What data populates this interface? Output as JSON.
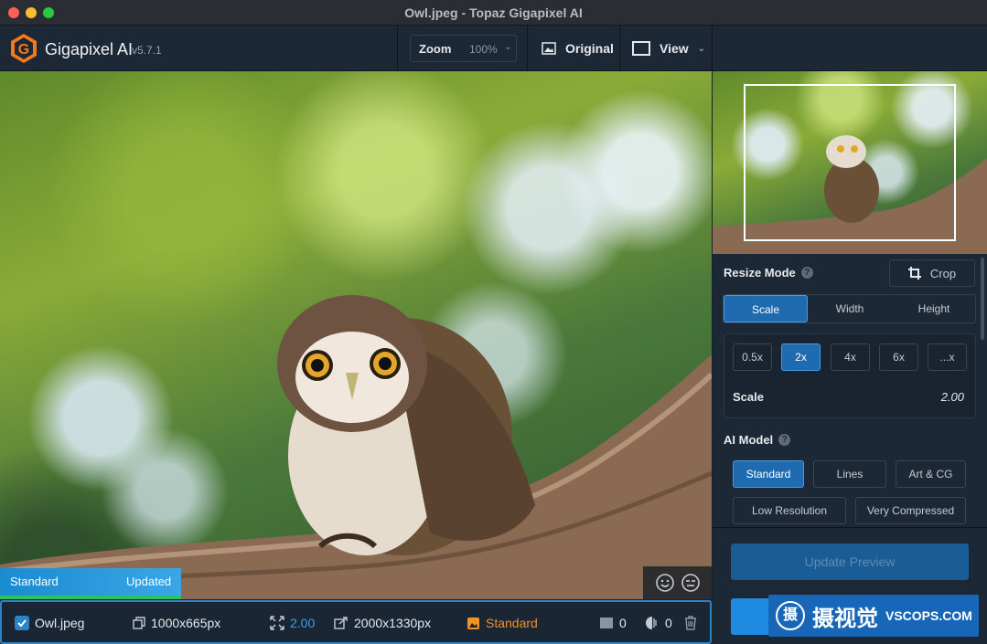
{
  "window": {
    "title": "Owl.jpeg - Topaz Gigapixel AI"
  },
  "app": {
    "name": "Gigapixel AI",
    "version": "v5.7.1",
    "accent": "#2c84c8"
  },
  "toolbar": {
    "zoom_label": "Zoom",
    "zoom_value": "100%",
    "original_label": "Original",
    "view_label": "View"
  },
  "preview": {
    "left_badge": "Standard",
    "right_badge": "Updated"
  },
  "file": {
    "name": "Owl.jpeg",
    "checked": true,
    "input_size": "1000x665px",
    "scale": "2.00",
    "output_size": "2000x1330px",
    "model": "Standard",
    "noise": "0",
    "blur": "0"
  },
  "panel": {
    "resize_mode_label": "Resize Mode",
    "crop_label": "Crop",
    "modes": [
      "Scale",
      "Width",
      "Height"
    ],
    "active_mode": "Scale",
    "scale_chips": [
      "0.5x",
      "2x",
      "4x",
      "6x",
      "...x"
    ],
    "active_scale": "2x",
    "scale_label": "Scale",
    "scale_value": "2.00",
    "ai_model_label": "AI Model",
    "models": [
      "Standard",
      "Lines",
      "Art & CG",
      "Low Resolution",
      "Very Compressed"
    ],
    "active_model": "Standard",
    "update_preview_label": "Update Preview"
  },
  "watermark": {
    "cn": "摄视觉",
    "en": "VSCOPS.COM",
    "logo": "摄"
  }
}
